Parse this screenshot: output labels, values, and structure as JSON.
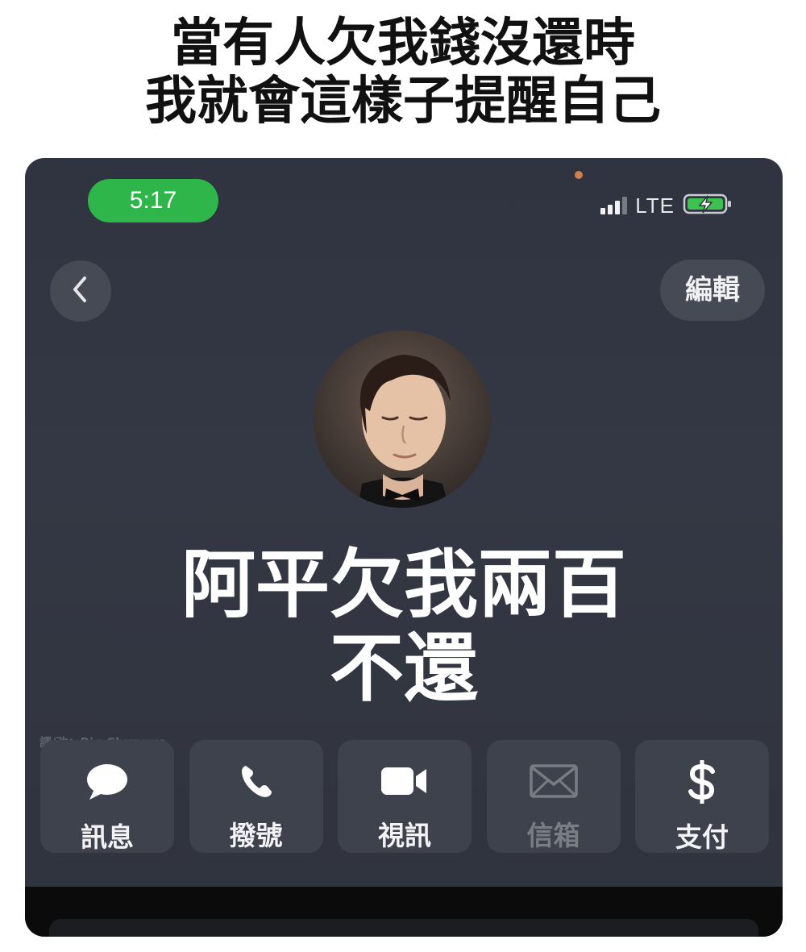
{
  "caption": {
    "line1": "當有人欠我錢沒還時",
    "line2": "我就會這樣子提醒自己"
  },
  "status_bar": {
    "time": "5:17",
    "network": "LTE",
    "signal_bars": 3,
    "signal_max": 4,
    "battery_icon": "battery-charging-icon",
    "time_pill_color": "#2fb64a"
  },
  "nav": {
    "back_icon": "chevron-left-icon",
    "edit_label": "編輯"
  },
  "contact": {
    "name_line1": "阿平欠我兩百",
    "name_line2": "不還"
  },
  "watermark": "譯/改：Big Chungus",
  "actions": [
    {
      "label": "訊息",
      "icon": "message-bubble-icon",
      "enabled": true
    },
    {
      "label": "撥號",
      "icon": "phone-icon",
      "enabled": true
    },
    {
      "label": "視訊",
      "icon": "video-camera-icon",
      "enabled": true
    },
    {
      "label": "信箱",
      "icon": "mail-icon",
      "enabled": false
    },
    {
      "label": "支付",
      "icon": "dollar-icon",
      "enabled": true
    }
  ]
}
